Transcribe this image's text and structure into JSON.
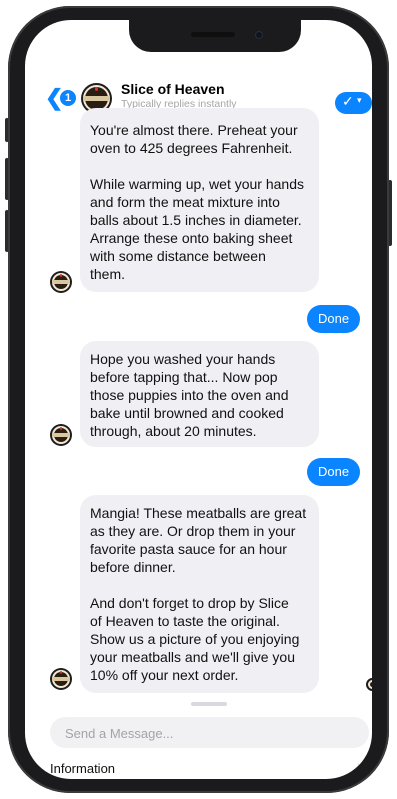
{
  "header": {
    "back_glyph": "❮",
    "unread_count": "1",
    "title": "Slice of Heaven",
    "subtitle": "Typically replies instantly",
    "action_glyph": "✓",
    "action_caret": "▾"
  },
  "messages": [
    {
      "from": "bot",
      "text": "You're almost there. Preheat your\noven to 425 degrees Fahrenheit.\n\nWhile warming up, wet your hands\nand form the meat mixture into\nballs about 1.5 inches in diameter.\nArrange these onto baking sheet\nwith some distance between\nthem."
    },
    {
      "from": "user",
      "text": "Done"
    },
    {
      "from": "bot",
      "text": "Hope you washed your hands\nbefore tapping that... Now pop\nthose puppies into the oven and\nbake until browned and cooked\nthrough, about 20 minutes."
    },
    {
      "from": "user",
      "text": "Done"
    },
    {
      "from": "bot",
      "text": "Mangia! These meatballs are great\nas they are. Or drop them in your\nfavorite pasta sauce for an hour\nbefore dinner.\n\nAnd don't forget to drop by Slice\nof Heaven to taste the original.\nShow us a picture of you enjoying\nyour meatballs and we'll give you\n10% off your next order."
    }
  ],
  "composer": {
    "placeholder": "Send a Message..."
  },
  "footer": {
    "info_label": "Information",
    "chevron_glyph": "›"
  },
  "colors": {
    "accent": "#0a84ff",
    "bubble_bot": "#f0eff4"
  }
}
